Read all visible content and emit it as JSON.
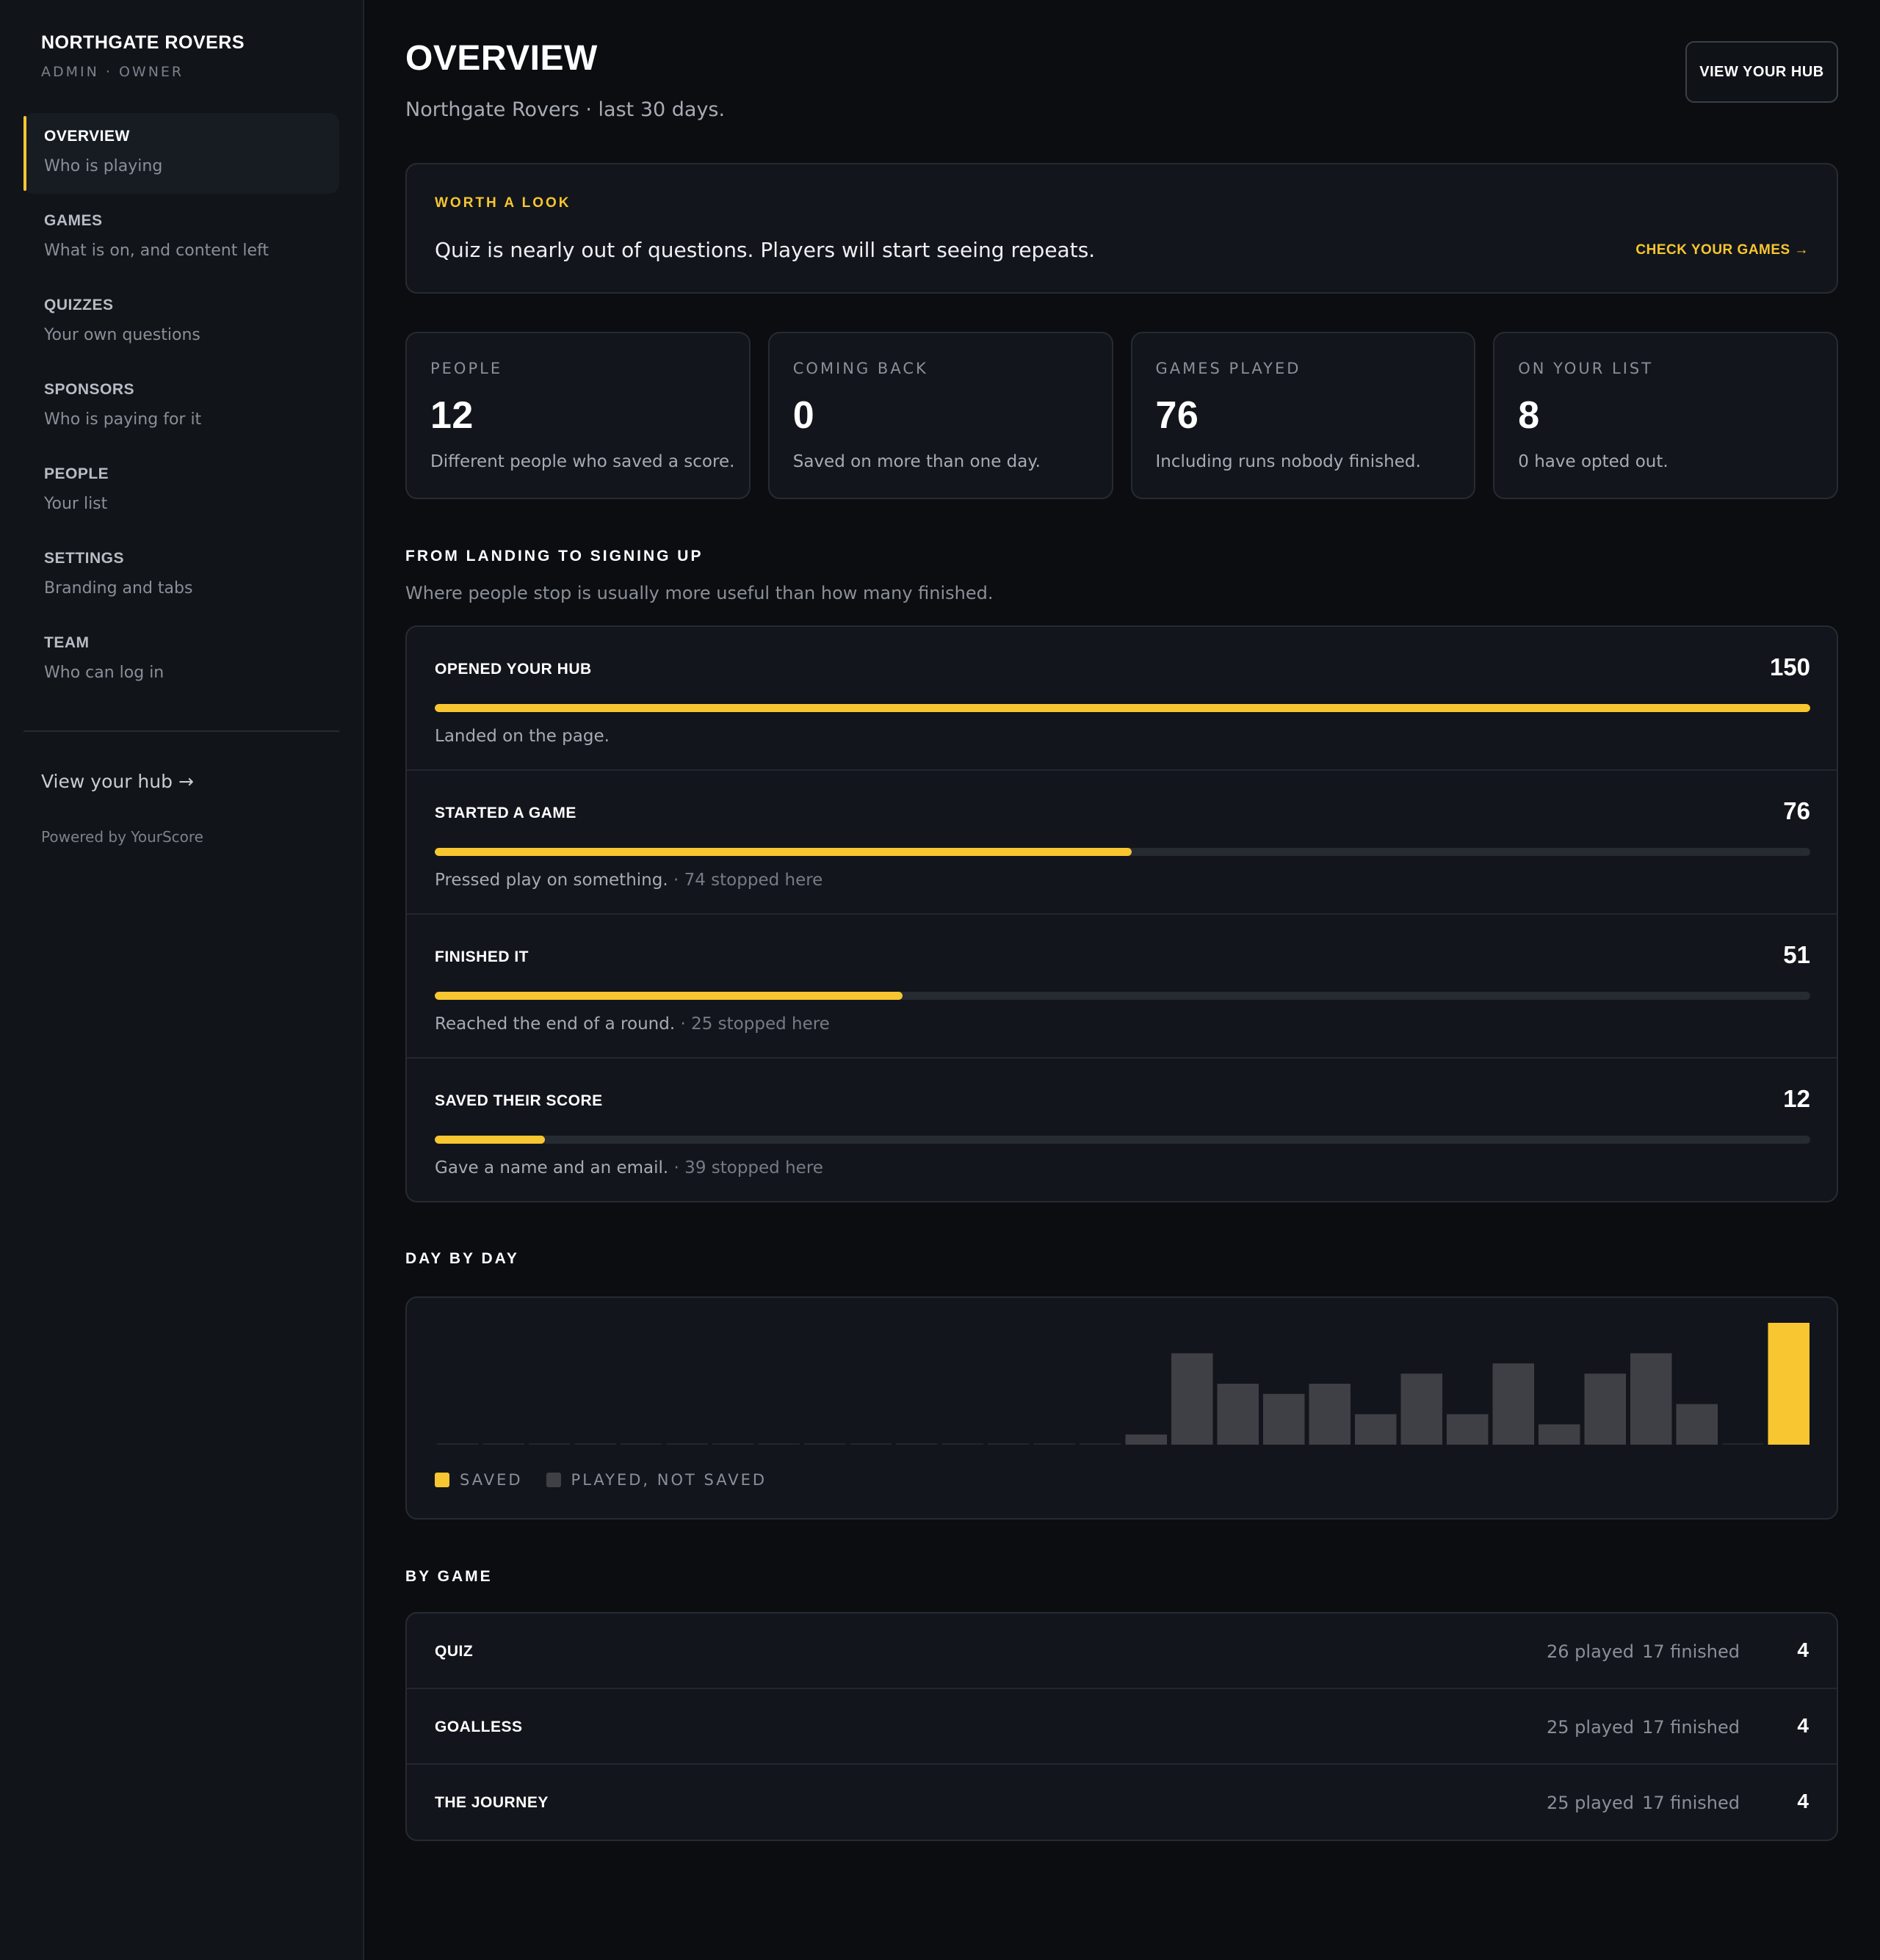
{
  "sidebar": {
    "brand_name": "NORTHGATE ROVERS",
    "role": "ADMIN · OWNER",
    "items": [
      {
        "title": "OVERVIEW",
        "sub": "Who is playing",
        "active": true
      },
      {
        "title": "GAMES",
        "sub": "What is on, and content left"
      },
      {
        "title": "QUIZZES",
        "sub": "Your own questions"
      },
      {
        "title": "SPONSORS",
        "sub": "Who is paying for it"
      },
      {
        "title": "PEOPLE",
        "sub": "Your list"
      },
      {
        "title": "SETTINGS",
        "sub": "Branding and tabs"
      },
      {
        "title": "TEAM",
        "sub": "Who can log in"
      }
    ],
    "view_hub": "View your hub →",
    "powered": "Powered by YourScore"
  },
  "header": {
    "title": "OVERVIEW",
    "subtitle": "Northgate Rovers · last 30 days.",
    "hub_button": "VIEW YOUR HUB"
  },
  "alert": {
    "label": "WORTH A LOOK",
    "text": "Quiz is nearly out of questions. Players will start seeing repeats.",
    "link": "CHECK YOUR GAMES →"
  },
  "stats": [
    {
      "label": "PEOPLE",
      "value": "12",
      "desc": "Different people who saved a score."
    },
    {
      "label": "COMING BACK",
      "value": "0",
      "desc": "Saved on more than one day."
    },
    {
      "label": "GAMES PLAYED",
      "value": "76",
      "desc": "Including runs nobody finished."
    },
    {
      "label": "ON YOUR LIST",
      "value": "8",
      "desc": "0 have opted out."
    }
  ],
  "funnel": {
    "title": "FROM LANDING TO SIGNING UP",
    "subtitle": "Where people stop is usually more useful than how many finished.",
    "steps": [
      {
        "label": "OPENED YOUR HUB",
        "count": "150",
        "value": 150,
        "note": "Landed on the page.",
        "stopped": ""
      },
      {
        "label": "STARTED A GAME",
        "count": "76",
        "value": 76,
        "note": "Pressed play on something.",
        "stopped": " · 74 stopped here"
      },
      {
        "label": "FINISHED IT",
        "count": "51",
        "value": 51,
        "note": "Reached the end of a round.",
        "stopped": " · 25 stopped here"
      },
      {
        "label": "SAVED THEIR SCORE",
        "count": "12",
        "value": 12,
        "note": "Gave a name and an email.",
        "stopped": " · 39 stopped here"
      }
    ]
  },
  "day_by_day": {
    "title": "DAY BY DAY",
    "legend_saved": "SAVED",
    "legend_played": "PLAYED, NOT SAVED",
    "saved_color": "#f8c630",
    "played_color": "#3f4045"
  },
  "chart_data": {
    "type": "bar",
    "stacked": true,
    "x": [
      1,
      2,
      3,
      4,
      5,
      6,
      7,
      8,
      9,
      10,
      11,
      12,
      13,
      14,
      15,
      16,
      17,
      18,
      19,
      20,
      21,
      22,
      23,
      24,
      25,
      26,
      27,
      28,
      29,
      30
    ],
    "series": [
      {
        "name": "SAVED",
        "values": [
          0,
          0,
          0,
          0,
          0,
          0,
          0,
          0,
          0,
          0,
          0,
          0,
          0,
          0,
          0,
          0,
          0,
          0,
          0,
          0,
          0,
          0,
          0,
          0,
          0,
          0,
          0,
          0,
          0,
          12
        ]
      },
      {
        "name": "PLAYED, NOT SAVED",
        "values": [
          0,
          0,
          0,
          0,
          0,
          0,
          0,
          0,
          0,
          0,
          0,
          0,
          0,
          0,
          0,
          1,
          9,
          6,
          5,
          6,
          3,
          7,
          3,
          8,
          2,
          7,
          9,
          4,
          0,
          0
        ]
      }
    ],
    "grid": false,
    "legend": "bottom-left"
  },
  "by_game": {
    "title": "BY GAME",
    "rows": [
      {
        "name": "QUIZ",
        "played": "26 played",
        "finished": "17 finished",
        "saved": "4"
      },
      {
        "name": "GOALLESS",
        "played": "25 played",
        "finished": "17 finished",
        "saved": "4"
      },
      {
        "name": "THE JOURNEY",
        "played": "25 played",
        "finished": "17 finished",
        "saved": "4"
      }
    ]
  }
}
